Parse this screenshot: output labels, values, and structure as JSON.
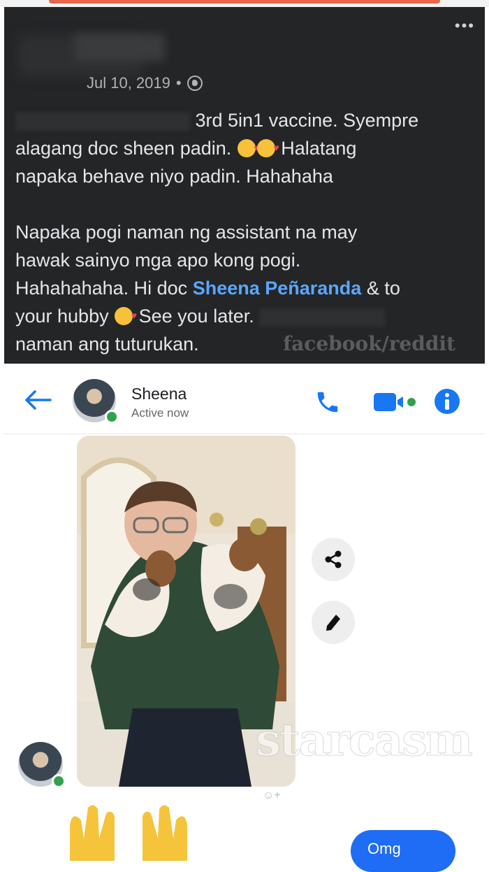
{
  "post": {
    "date": "Jul 10, 2019",
    "separator": "•",
    "audience_icon": "globe-icon",
    "more_icon": "•••",
    "line1_visible": "3rd 5in1 vaccine.  Syempre",
    "line2_a": "alagang doc sheen padin.",
    "line2_b": "Halatang",
    "line3": "napaka behave niyo padin. Hahahaha",
    "line4": "Napaka pogi naman ng assistant na may",
    "line5": "hawak sainyo mga apo kong pogi.",
    "line6_a": "Hahahahaha. Hi doc",
    "mention": "Sheena Peñaranda",
    "line6_b": "& to",
    "line7_a": "your hubby",
    "line7_b": "See you later.",
    "line8": "naman ang tuturukan.",
    "watermark": "facebook/reddit"
  },
  "messenger": {
    "contact_name": "Sheena",
    "status": "Active now",
    "bubble_text": "Omg",
    "watermark": "starcasm",
    "react_symbol": "☺+",
    "colors": {
      "accent": "#1877f2",
      "online": "#31a24c",
      "bubble": "#1f6cf5"
    }
  }
}
